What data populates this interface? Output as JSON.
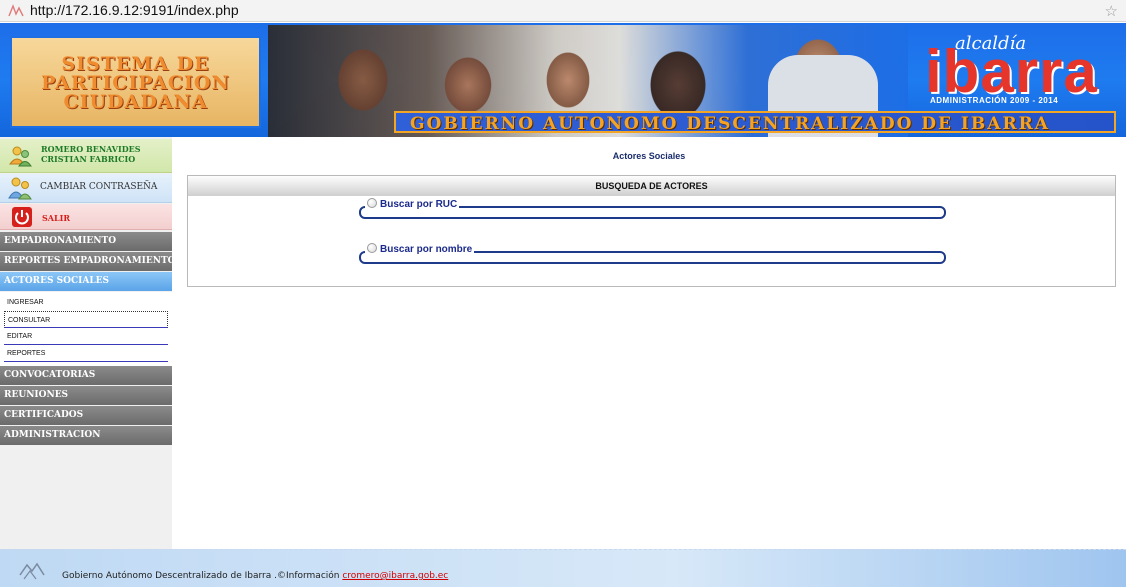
{
  "browser": {
    "url": "http://172.16.9.12:9191/index.php"
  },
  "banner": {
    "title_lines": [
      "SISTEMA DE",
      "PARTICIPACION",
      "CIUDADANA"
    ],
    "strip_text": "GOBIERNO AUTONOMO DESCENTRALIZADO DE IBARRA",
    "logo_script": "alcaldía",
    "logo_name": "ibarra",
    "logo_sub": "ADMINISTRACIÓN 2009 - 2014"
  },
  "sidebar": {
    "user_name_line1": "ROMERO BENAVIDES",
    "user_name_line2": "CRISTIAN FABRICIO",
    "change_password": "CAMBIAR CONTRASEÑA",
    "logout": "SALIR",
    "menu": [
      "EMPADRONAMIENTO",
      "REPORTES EMPADRONAMIENTO",
      "ACTORES SOCIALES",
      "CONVOCATORIAS",
      "REUNIONES",
      "CERTIFICADOS",
      "ADMINISTRACION"
    ],
    "submenu": [
      "INGRESAR",
      "CONSULTAR",
      "EDITAR",
      "REPORTES"
    ]
  },
  "main": {
    "heading": "Actores Sociales",
    "panel_title": "BUSQUEDA DE ACTORES",
    "search_ruc": "Buscar por RUC",
    "search_name": "Buscar por nombre"
  },
  "footer": {
    "text": "Gobierno Autónomo Descentralizado de Ibarra .©Información ",
    "email": "cromero@ibarra.gob.ec"
  },
  "colors": {
    "banner_blue": "#1f7bf0",
    "active_menu": "#5aa4e8",
    "menu_gray": "#7a7a7a",
    "legend_blue": "#1c2b8b",
    "strip_orange": "#f5a322",
    "logo_red": "#e6352b"
  }
}
